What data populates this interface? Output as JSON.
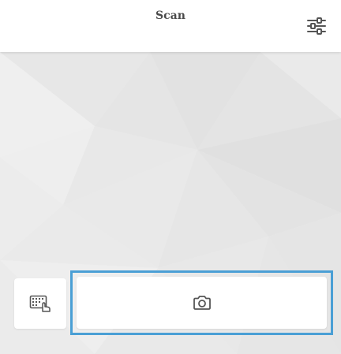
{
  "header": {
    "title": "Scan"
  },
  "icons": {
    "settings": "sliders-icon",
    "keypad": "keypad-touch-icon",
    "camera": "camera-icon"
  },
  "colors": {
    "header_bg": "#ffffff",
    "background": "#ececec",
    "focus_outline": "#4a9fd5",
    "icon": "#555555",
    "title_text": "#4a4a4a"
  }
}
